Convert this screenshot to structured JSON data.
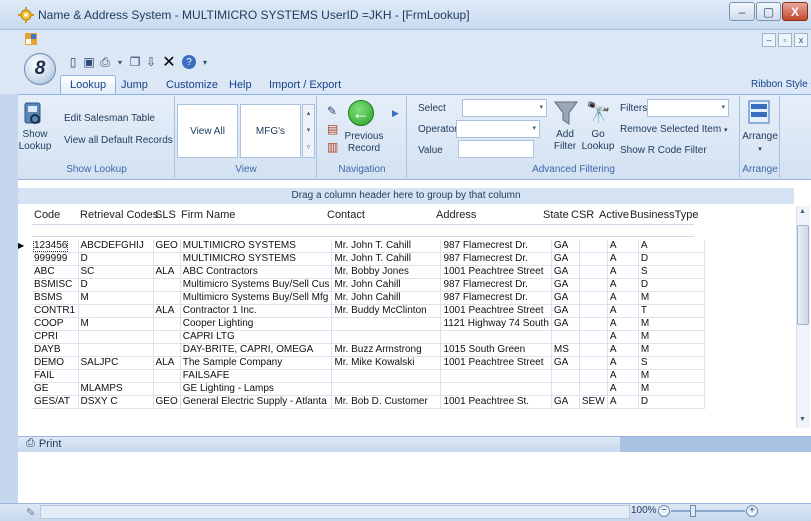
{
  "window": {
    "title": "Name & Address System - MULTIMICRO SYSTEMS  UserID =JKH - [FrmLookup]",
    "orb_label": "8",
    "minimize": "–",
    "maximize": "▢",
    "close": "X"
  },
  "mdi": {
    "minimize": "–",
    "restore": "▫",
    "close": "x"
  },
  "tabs": [
    "Lookup",
    "Jump",
    "Customize",
    "Help",
    "Import / Export"
  ],
  "ribbon_style": "Ribbon Style",
  "groups": {
    "show_lookup": "Show Lookup",
    "view": "View",
    "navigation": "Navigation",
    "advanced_filtering": "Advanced Filtering",
    "arrange": "Arrange"
  },
  "show_lookup": {
    "show_button": "Show\nLookup",
    "edit_salesman": "Edit Salesman Table",
    "view_defaults": "View all Default Records"
  },
  "view": {
    "view_all": "View All",
    "mfg": "MFG's"
  },
  "navigation": {
    "previous_record": "Previous\nRecord"
  },
  "filtering": {
    "select_label": "Select",
    "operator_label": "Operator",
    "value_label": "Value",
    "add_filter": "Add\nFilter",
    "go_lookup": "Go\nLookup",
    "filters_label": "Filters",
    "remove_selected": "Remove Selected Item",
    "show_r_code": "Show R Code Filter"
  },
  "arrange": {
    "label": "Arrange"
  },
  "grid": {
    "group_prompt": "Drag a column header here to group by that column",
    "columns": [
      "Code",
      "Retrieval Codes",
      "SLS",
      "Firm Name",
      "Contact",
      "Address",
      "State",
      "CSR",
      "Active",
      "BusinessType"
    ],
    "rows": [
      [
        "123456",
        "ABCDEFGHIJ",
        "GEO",
        "MULTIMICRO SYSTEMS",
        "Mr. John T. Cahill",
        "987 Flamecrest Dr.",
        "GA",
        "",
        "A",
        "A"
      ],
      [
        "999999",
        "D",
        "",
        "MULTIMICRO SYSTEMS",
        "Mr. John T. Cahill",
        "987 Flamecrest Dr.",
        "GA",
        "",
        "A",
        "D"
      ],
      [
        "ABC",
        "SC",
        "ALA",
        "ABC Contractors",
        "Mr. Bobby Jones",
        "1001 Peachtree Street",
        "GA",
        "",
        "A",
        "S"
      ],
      [
        "BSMISC",
        "D",
        "",
        "Multimicro Systems Buy/Sell Cus",
        "Mr. John Cahill",
        "987 Flamecrest Dr.",
        "GA",
        "",
        "A",
        "D"
      ],
      [
        "BSMS",
        "M",
        "",
        "Multimicro Systems Buy/Sell Mfg",
        "Mr. John Cahill",
        "987 Flamecrest Dr.",
        "GA",
        "",
        "A",
        "M"
      ],
      [
        "CONTR1",
        "",
        "ALA",
        "Contractor 1 Inc.",
        "Mr. Buddy  McClinton",
        "1001 Peachtree Street",
        "GA",
        "",
        "A",
        "T"
      ],
      [
        "COOP",
        "M",
        "",
        "Cooper Lighting",
        "",
        "1121 Highway 74 South",
        "GA",
        "",
        "A",
        "M"
      ],
      [
        "CPRI",
        "",
        "",
        "CAPRI LTG",
        "",
        "",
        "",
        "",
        "A",
        "M"
      ],
      [
        "DAYB",
        "",
        "",
        "DAY-BRITE, CAPRI, OMEGA",
        "Mr. Buzz Armstrong",
        "1015 South Green",
        "MS",
        "",
        "A",
        "M"
      ],
      [
        "DEMO",
        "SALJPC",
        "ALA",
        "The Sample Company",
        "Mr. Mike Kowalski",
        "1001 Peachtree Street",
        "GA",
        "",
        "A",
        "S"
      ],
      [
        "FAIL",
        "",
        "",
        "FAILSAFE",
        "",
        "",
        "",
        "",
        "A",
        "M"
      ],
      [
        "GE",
        "MLAMPS",
        "",
        "GE Lighting - Lamps",
        "",
        "",
        "",
        "",
        "A",
        "M"
      ],
      [
        "GES/AT",
        "DSXY    C",
        "GEO",
        "General Electric Supply - Atlanta",
        "Mr. Bob D. Customer",
        "1001 Peachtree St.",
        "GA",
        "SEW",
        "A",
        "D"
      ]
    ]
  },
  "print_label": "Print",
  "zoom": {
    "label": "100%",
    "minus": "−",
    "plus": "+"
  }
}
